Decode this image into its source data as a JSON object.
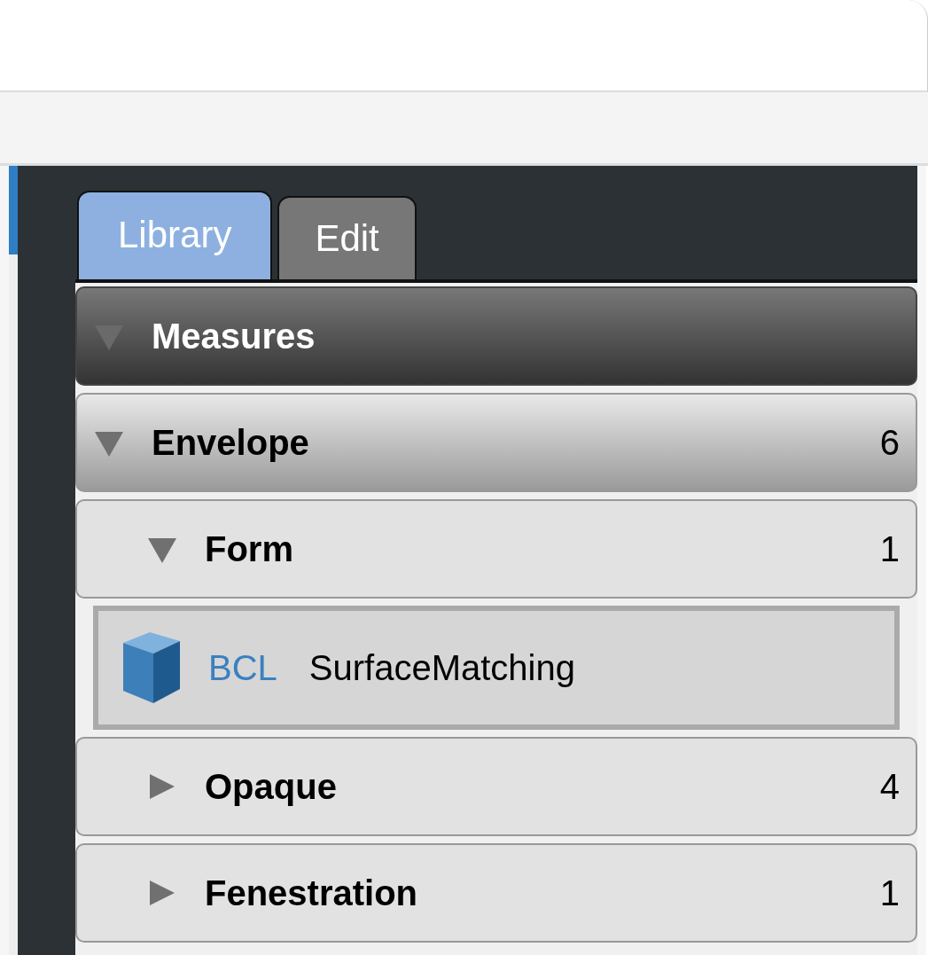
{
  "tabs": [
    {
      "label": "Library",
      "selected": true
    },
    {
      "label": "Edit",
      "selected": false
    }
  ],
  "tree": {
    "label": "Measures",
    "expanded": true,
    "children": [
      {
        "label": "Envelope",
        "count": "6",
        "expanded": true,
        "children": [
          {
            "label": "Form",
            "count": "1",
            "expanded": true,
            "children": [
              {
                "kind": "measure",
                "source": "BCL",
                "name": "SurfaceMatching"
              }
            ]
          },
          {
            "label": "Opaque",
            "count": "4",
            "expanded": false
          },
          {
            "label": "Fenestration",
            "count": "1",
            "expanded": false
          }
        ]
      }
    ]
  }
}
